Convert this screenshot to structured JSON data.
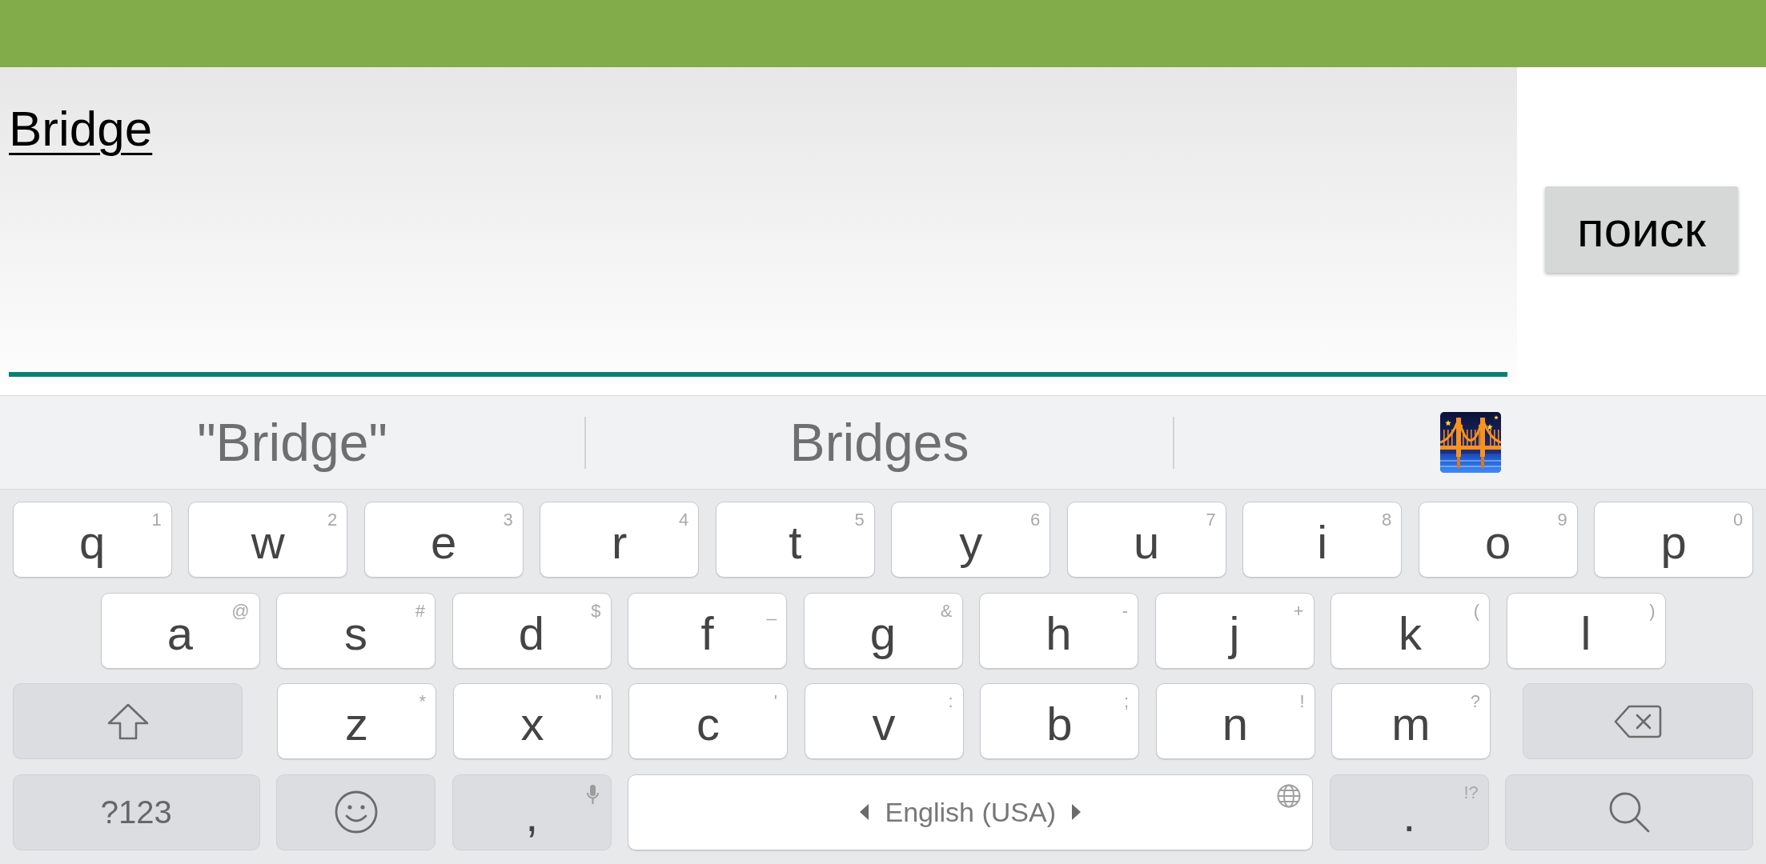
{
  "search": {
    "value": "Bridge",
    "button": "поиск"
  },
  "keyboard": {
    "suggestions": [
      {
        "kind": "text",
        "label": "\"Bridge\""
      },
      {
        "kind": "text",
        "label": "Bridges"
      },
      {
        "kind": "emoji"
      }
    ],
    "rows": [
      {
        "keys": [
          {
            "kind": "letter",
            "label": "q",
            "hint": "1"
          },
          {
            "kind": "letter",
            "label": "w",
            "hint": "2"
          },
          {
            "kind": "letter",
            "label": "e",
            "hint": "3"
          },
          {
            "kind": "letter",
            "label": "r",
            "hint": "4"
          },
          {
            "kind": "letter",
            "label": "t",
            "hint": "5"
          },
          {
            "kind": "letter",
            "label": "y",
            "hint": "6"
          },
          {
            "kind": "letter",
            "label": "u",
            "hint": "7"
          },
          {
            "kind": "letter",
            "label": "i",
            "hint": "8"
          },
          {
            "kind": "letter",
            "label": "o",
            "hint": "9"
          },
          {
            "kind": "letter",
            "label": "p",
            "hint": "0"
          }
        ]
      },
      {
        "keys": [
          {
            "kind": "letter",
            "label": "a",
            "hint": "@"
          },
          {
            "kind": "letter",
            "label": "s",
            "hint": "#"
          },
          {
            "kind": "letter",
            "label": "d",
            "hint": "$"
          },
          {
            "kind": "letter",
            "label": "f",
            "hint": "_"
          },
          {
            "kind": "letter",
            "label": "g",
            "hint": "&"
          },
          {
            "kind": "letter",
            "label": "h",
            "hint": "-"
          },
          {
            "kind": "letter",
            "label": "j",
            "hint": "+"
          },
          {
            "kind": "letter",
            "label": "k",
            "hint": "("
          },
          {
            "kind": "letter",
            "label": "l",
            "hint": ")"
          }
        ]
      },
      {
        "keys": [
          {
            "kind": "shift"
          },
          {
            "kind": "letter",
            "label": "z",
            "hint": "*"
          },
          {
            "kind": "letter",
            "label": "x",
            "hint": "\""
          },
          {
            "kind": "letter",
            "label": "c",
            "hint": "'"
          },
          {
            "kind": "letter",
            "label": "v",
            "hint": ":"
          },
          {
            "kind": "letter",
            "label": "b",
            "hint": ";"
          },
          {
            "kind": "letter",
            "label": "n",
            "hint": "!"
          },
          {
            "kind": "letter",
            "label": "m",
            "hint": "?"
          },
          {
            "kind": "delete"
          }
        ]
      },
      {
        "keys": [
          {
            "kind": "symbols",
            "label": "?123"
          },
          {
            "kind": "emoji"
          },
          {
            "kind": "comma",
            "label": ","
          },
          {
            "kind": "space",
            "label": "English (USA)"
          },
          {
            "kind": "period",
            "label": ".",
            "hint": "!?"
          },
          {
            "kind": "search"
          }
        ]
      }
    ]
  }
}
